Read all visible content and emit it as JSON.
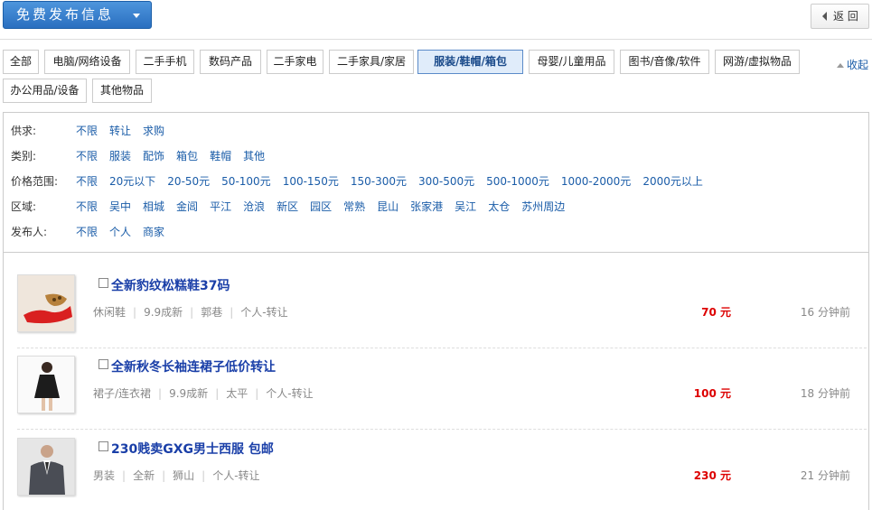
{
  "topbar": {
    "post_label": "免费发布信息",
    "back_label": "返 回"
  },
  "categories": [
    "全部",
    "电脑/网络设备",
    "二手手机",
    "数码产品",
    "二手家电",
    "二手家具/家居",
    "服装/鞋帽/箱包",
    "母婴/儿童用品",
    "图书/音像/软件",
    "网游/虚拟物品",
    "办公用品/设备",
    "其他物品"
  ],
  "active_category": "服装/鞋帽/箱包",
  "collapse_label": "收起",
  "filters": [
    {
      "label": "供求:",
      "options": [
        "不限",
        "转让",
        "求购"
      ]
    },
    {
      "label": "类别:",
      "options": [
        "不限",
        "服装",
        "配饰",
        "箱包",
        "鞋帽",
        "其他"
      ]
    },
    {
      "label": "价格范围:",
      "options": [
        "不限",
        "20元以下",
        "20-50元",
        "50-100元",
        "100-150元",
        "150-300元",
        "300-500元",
        "500-1000元",
        "1000-2000元",
        "2000元以上"
      ]
    },
    {
      "label": "区域:",
      "options": [
        "不限",
        "吴中",
        "相城",
        "金阊",
        "平江",
        "沧浪",
        "新区",
        "园区",
        "常熟",
        "昆山",
        "张家港",
        "吴江",
        "太仓",
        "苏州周边"
      ]
    },
    {
      "label": "发布人:",
      "options": [
        "不限",
        "个人",
        "商家"
      ]
    }
  ],
  "listings": [
    {
      "title": "全新豹纹松糕鞋37码",
      "meta": [
        "休闲鞋",
        "9.9成新",
        "郭巷",
        "个人-转让"
      ],
      "price": "70 元",
      "time": "16 分钟前",
      "thumb": "shoe-thumbnail"
    },
    {
      "title": "全新秋冬长袖连裙子低价转让",
      "meta": [
        "裙子/连衣裙",
        "9.9成新",
        "太平",
        "个人-转让"
      ],
      "price": "100 元",
      "time": "18 分钟前",
      "thumb": "dress-thumbnail"
    },
    {
      "title": "230贱卖GXG男士西服 包邮",
      "meta": [
        "男装",
        "全新",
        "狮山",
        "个人-转让"
      ],
      "price": "230 元",
      "time": "21 分钟前",
      "thumb": "suit-thumbnail"
    }
  ],
  "colors": {
    "accent": "#1a5ca8",
    "price": "#dd0000",
    "title": "#1a3fa8"
  }
}
